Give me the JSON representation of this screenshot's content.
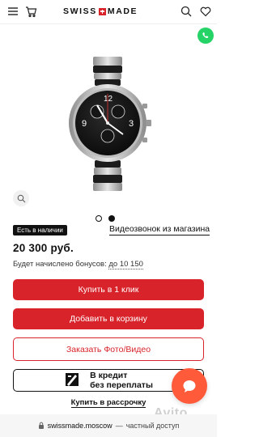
{
  "header": {
    "logo_left": "SWISS",
    "logo_right": "MADE",
    "icons": [
      "menu-icon",
      "cart-icon",
      "search-icon",
      "heart-icon"
    ]
  },
  "product": {
    "stock_badge": "Есть в наличии",
    "video_call": "Видеозвонок из магазина",
    "price": "20 300 руб.",
    "bonus_prefix": "Будет начислено бонусов:",
    "bonus_amount": "до 10 150",
    "gallery_slides": 2,
    "active_slide": 2
  },
  "buttons": {
    "one_click": "Купить в 1 клик",
    "add_to_cart": "Добавить в корзину",
    "order_photo": "Заказать Фото/Видео",
    "credit_line1": "В кредит",
    "credit_line2": "без переплаты",
    "installment": "Купить в рассрочку"
  },
  "watermark": "Avito",
  "browser": {
    "domain": "swissmade.moscow",
    "separator": "—",
    "status": "частный доступ"
  },
  "colors": {
    "accent": "#d8232a",
    "whatsapp": "#25d366",
    "chat_fab": "#ff5a3a"
  }
}
